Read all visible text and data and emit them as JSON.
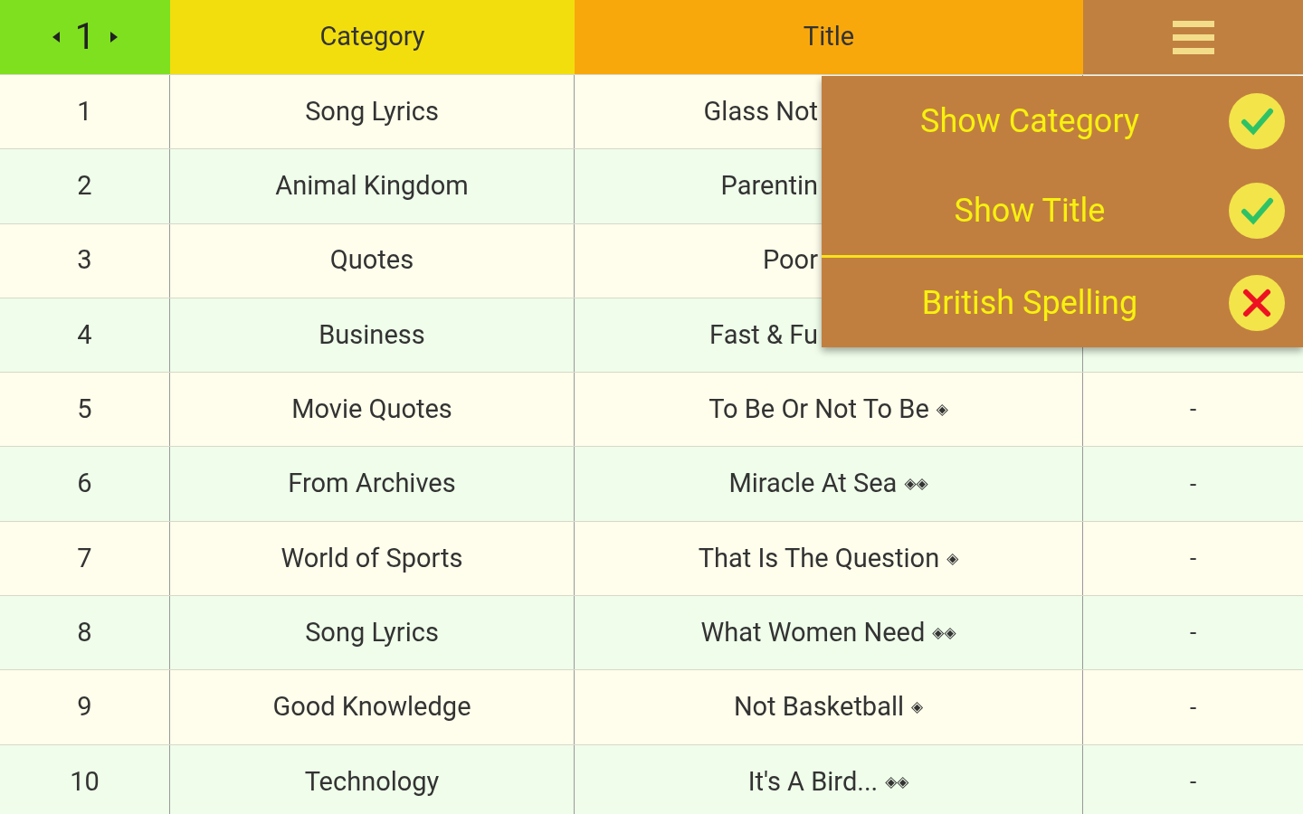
{
  "header": {
    "page": "1",
    "columns": [
      "Category",
      "Title"
    ]
  },
  "rows": [
    {
      "number": "1",
      "category": "Song Lyrics",
      "title": "Glass Not"
    },
    {
      "number": "2",
      "category": "Animal Kingdom",
      "title": "Parentin"
    },
    {
      "number": "3",
      "category": "Quotes",
      "title": "Poor"
    },
    {
      "number": "4",
      "category": "Business",
      "title": "Fast & Fu"
    },
    {
      "number": "5",
      "category": "Movie Quotes",
      "title": "To Be Or Not To Be",
      "marks": "◈",
      "column_4": "-"
    },
    {
      "number": "6",
      "category": "From Archives",
      "title": "Miracle At Sea",
      "marks": "◈◈",
      "column_4": "-"
    },
    {
      "number": "7",
      "category": "World of Sports",
      "title": "That Is The Question",
      "marks": "◈",
      "column_4": "-"
    },
    {
      "number": "8",
      "category": "Song Lyrics",
      "title": "What Women Need",
      "marks": "◈◈",
      "column_4": "-"
    },
    {
      "number": "9",
      "category": "Good Knowledge",
      "title": "Not Basketball",
      "marks": "◈",
      "column_4": "-"
    },
    {
      "number": "10",
      "category": "Technology",
      "title": "It's A Bird...",
      "marks": "◈◈",
      "column_4": "-"
    }
  ],
  "menu": {
    "groups": [
      [
        {
          "label": "Show Category",
          "checked": true
        },
        {
          "label": "Show Title",
          "checked": true
        }
      ],
      [
        {
          "label": "British Spelling",
          "checked": false
        }
      ]
    ]
  }
}
